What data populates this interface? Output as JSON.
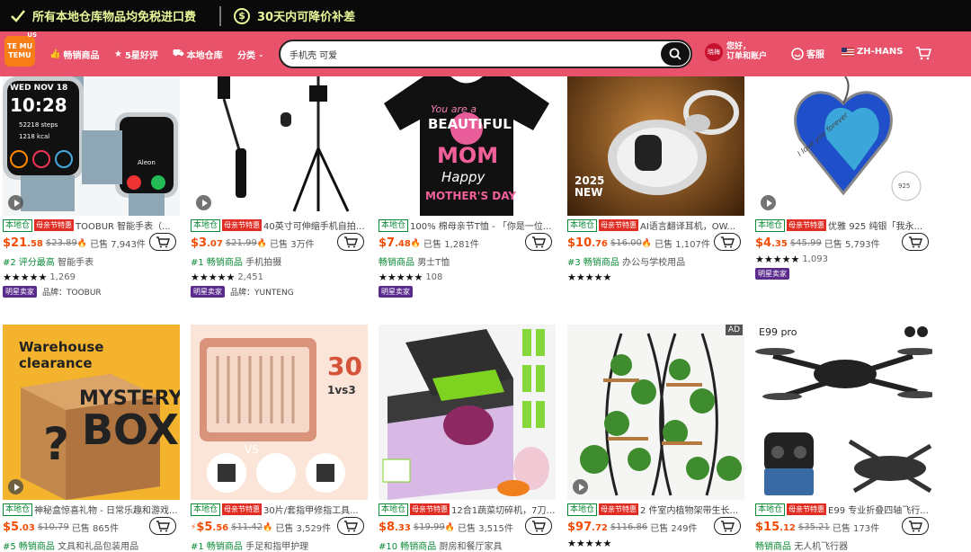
{
  "topbar": {
    "promo1": "所有本地仓库物品均免税进口费",
    "promo2": "30天内可降价补差",
    "dollar": "$"
  },
  "nav": {
    "logo_line1": "TE MU",
    "logo_line2": "TEMU",
    "region": "US",
    "best_sellers": "畅销商品",
    "five_star": "5星好评",
    "local_warehouse": "本地仓库",
    "categories": "分类",
    "search_value": "手机壳 可爱",
    "account_avatar": "晓梅",
    "account_line1": "您好，",
    "account_line2": "订单和账户",
    "service": "客服",
    "language": "ZH-HANS"
  },
  "products": [
    {
      "title": "TOOBUR 智能手表（...",
      "price_int": "$21",
      "price_dec": ".58",
      "orig": "$23.89",
      "sold": "已售 7,943件",
      "rank": "#2 评分最高",
      "cat": "智能手表",
      "stars": "★★★★★",
      "reviews": "1,269",
      "star_seller": "明星卖家",
      "brand_label": "品牌：TOOBUR",
      "fest": true,
      "fire": true,
      "img_text": "WED NOV 18 10:28 52218 steps 1218 kcal Aleon"
    },
    {
      "title": "40英寸可伸缩手机自拍杆，专为...",
      "price_int": "$3",
      "price_dec": ".07",
      "orig": "$21.99",
      "sold": "已售 3万件",
      "rank": "#1 畅销商品",
      "cat": "手机拍摄",
      "stars": "★★★★★",
      "reviews": "2,451",
      "star_seller": "明星卖家",
      "brand_label": "品牌：YUNTENG",
      "fest": true,
      "fire": true
    },
    {
      "title": "100% 棉母亲节T恤 - 「你是一位...",
      "price_int": "$7",
      "price_dec": ".48",
      "orig": "",
      "sold": "已售 1,281件",
      "rank": "畅销商品",
      "cat": "男士T恤",
      "stars": "★★★★★",
      "reviews": "108",
      "star_seller": "明星卖家",
      "brand_label": "",
      "fest": false,
      "fire": true,
      "img_text": "You are a BEAUTIFUL MOM Happy MOTHER'S DAY"
    },
    {
      "title": "AI语言翻译耳机，OW...",
      "price_int": "$10",
      "price_dec": ".76",
      "orig": "$16.00",
      "sold": "已售 1,107件",
      "rank": "#3 畅销商品",
      "cat": "办公与学校用品",
      "stars": "★★★★★",
      "reviews": "",
      "star_seller": "",
      "brand_label": "",
      "fest": true,
      "fire": true,
      "img_text": "2025 NEW"
    },
    {
      "title": "优雅 925 纯银「我永...",
      "price_int": "$4",
      "price_dec": ".35",
      "orig": "$45.99",
      "sold": "已售 5,793件",
      "rank": "",
      "cat": "",
      "stars": "★★★★★",
      "reviews": "1,093",
      "star_seller": "明星卖家",
      "brand_label": "",
      "fest": true,
      "fire": false,
      "img_text": "I love you forever 925"
    },
    {
      "title": "神秘盒惊喜礼物 - 日常乐趣和游戏...",
      "price_int": "$5",
      "price_dec": ".03",
      "orig": "$10.79",
      "sold": "已售 865件",
      "rank": "#5 畅销商品",
      "cat": "文具和礼品包装用品",
      "fest": false,
      "fire": false,
      "img_text": "Warehouse clearance MYSTERY BOX"
    },
    {
      "title": "30片/套指甲修指工具...",
      "price_int": "$5",
      "price_dec": ".56",
      "orig": "$11.42",
      "sold": "已售 3,529件",
      "rank": "#1 畅销商品",
      "cat": "手足和指甲护理",
      "fest": true,
      "fire": true,
      "flash": true,
      "img_text": "30 1vs3 VS"
    },
    {
      "title": "12合1蔬菜切碎机，7刀蔬菜切碎...",
      "price_int": "$8",
      "price_dec": ".33",
      "orig": "$19.99",
      "sold": "已售 3,515件",
      "rank": "#10 畅销商品",
      "cat": "厨房和餐厅家具",
      "fest": true,
      "fire": true
    },
    {
      "title": "2 件室内植物架带生长...",
      "price_int": "$97",
      "price_dec": ".72",
      "orig": "$116.86",
      "sold": "已售 249件",
      "rank": "",
      "cat": "",
      "stars": "★★★★★",
      "fest": true,
      "fire": false,
      "ad": "AD"
    },
    {
      "title": "E99 专业折叠四轴飞行...",
      "price_int": "$15",
      "price_dec": ".12",
      "orig": "$35.21",
      "sold": "已售 173件",
      "rank": "畅销商品",
      "cat": "无人机飞行器",
      "fest": true,
      "fire": false,
      "img_text": "E99 pro"
    }
  ],
  "labels": {
    "local": "本地仓",
    "fest": "母亲节特惠"
  }
}
